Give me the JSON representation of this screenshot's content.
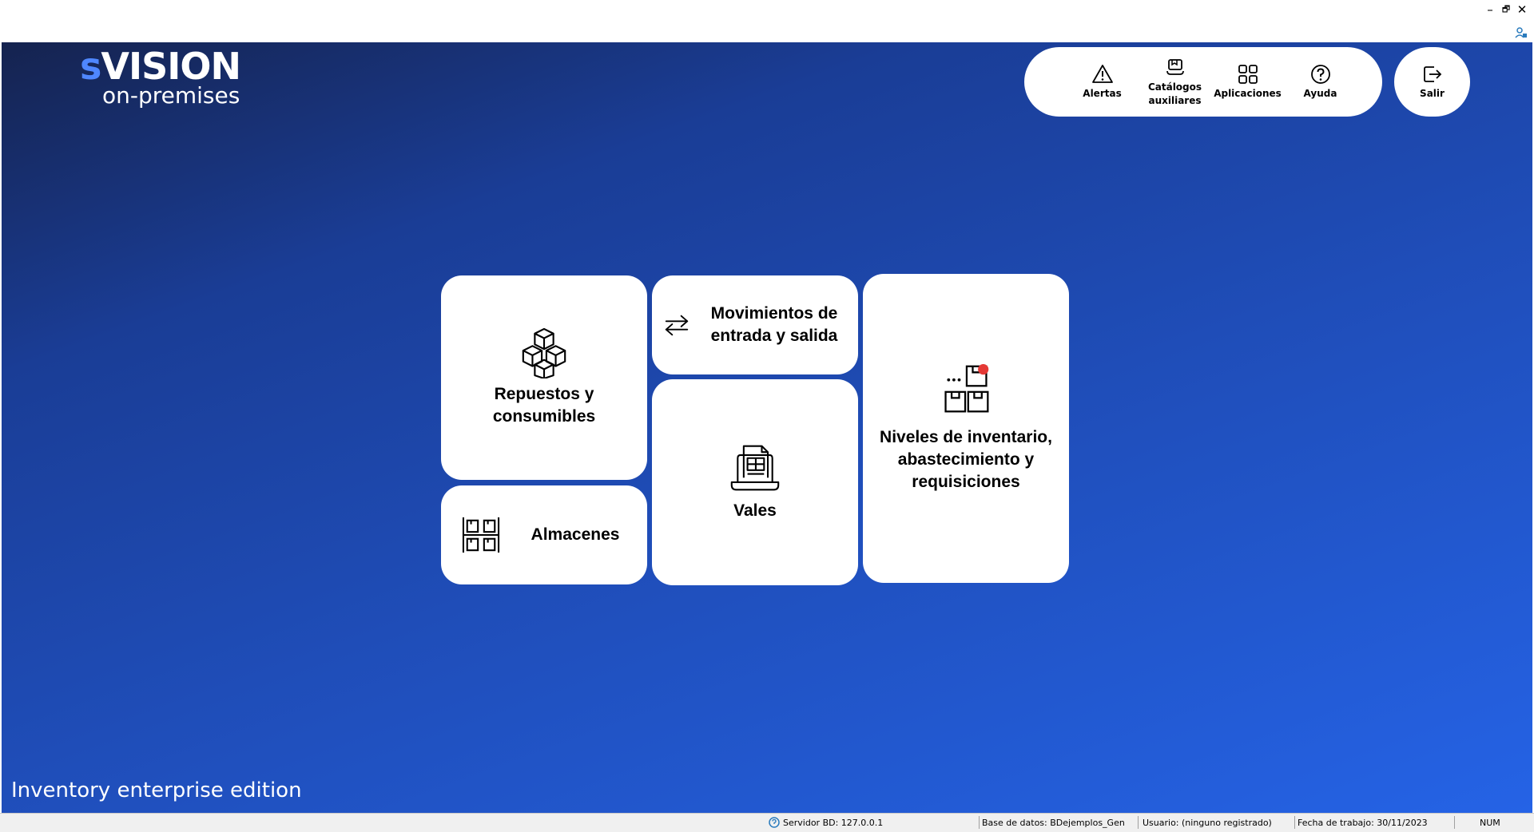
{
  "window": {
    "minimize_glyph": "–",
    "restore_glyph": "🗗",
    "close_glyph": "✕"
  },
  "brand": {
    "logo_initial": "s",
    "logo_rest": "VISION",
    "tagline": "on-premises",
    "accent_color": "#4f87ff"
  },
  "toolbar": {
    "items": [
      {
        "label": "Alertas",
        "icon": "warning-triangle-icon"
      },
      {
        "label": "Catálogos\nauxiliares",
        "icon": "catalog-stack-icon"
      },
      {
        "label": "Aplicaciones",
        "icon": "apps-grid-icon"
      },
      {
        "label": "Ayuda",
        "icon": "help-circle-icon"
      }
    ],
    "exit_label": "Salir"
  },
  "tiles": {
    "repuestos": "Repuestos y consumibles",
    "movimientos": "Movimientos de entrada y salida",
    "vales": "Vales",
    "almacenes": "Almacenes",
    "niveles": "Niveles de inventario, abastecimiento y requisiciones"
  },
  "edition": "Inventory enterprise edition",
  "status": {
    "server": "Servidor BD: 127.0.0.1",
    "database": "Base de datos: BDejemplos_Gene...",
    "user": "Usuario: (ninguno registrado)",
    "date": "Fecha de trabajo: 30/11/2023",
    "num": "NUM"
  },
  "colors": {
    "gradient_start": "#15234f",
    "gradient_end": "#2563e6",
    "notification_dot": "#e53935"
  }
}
